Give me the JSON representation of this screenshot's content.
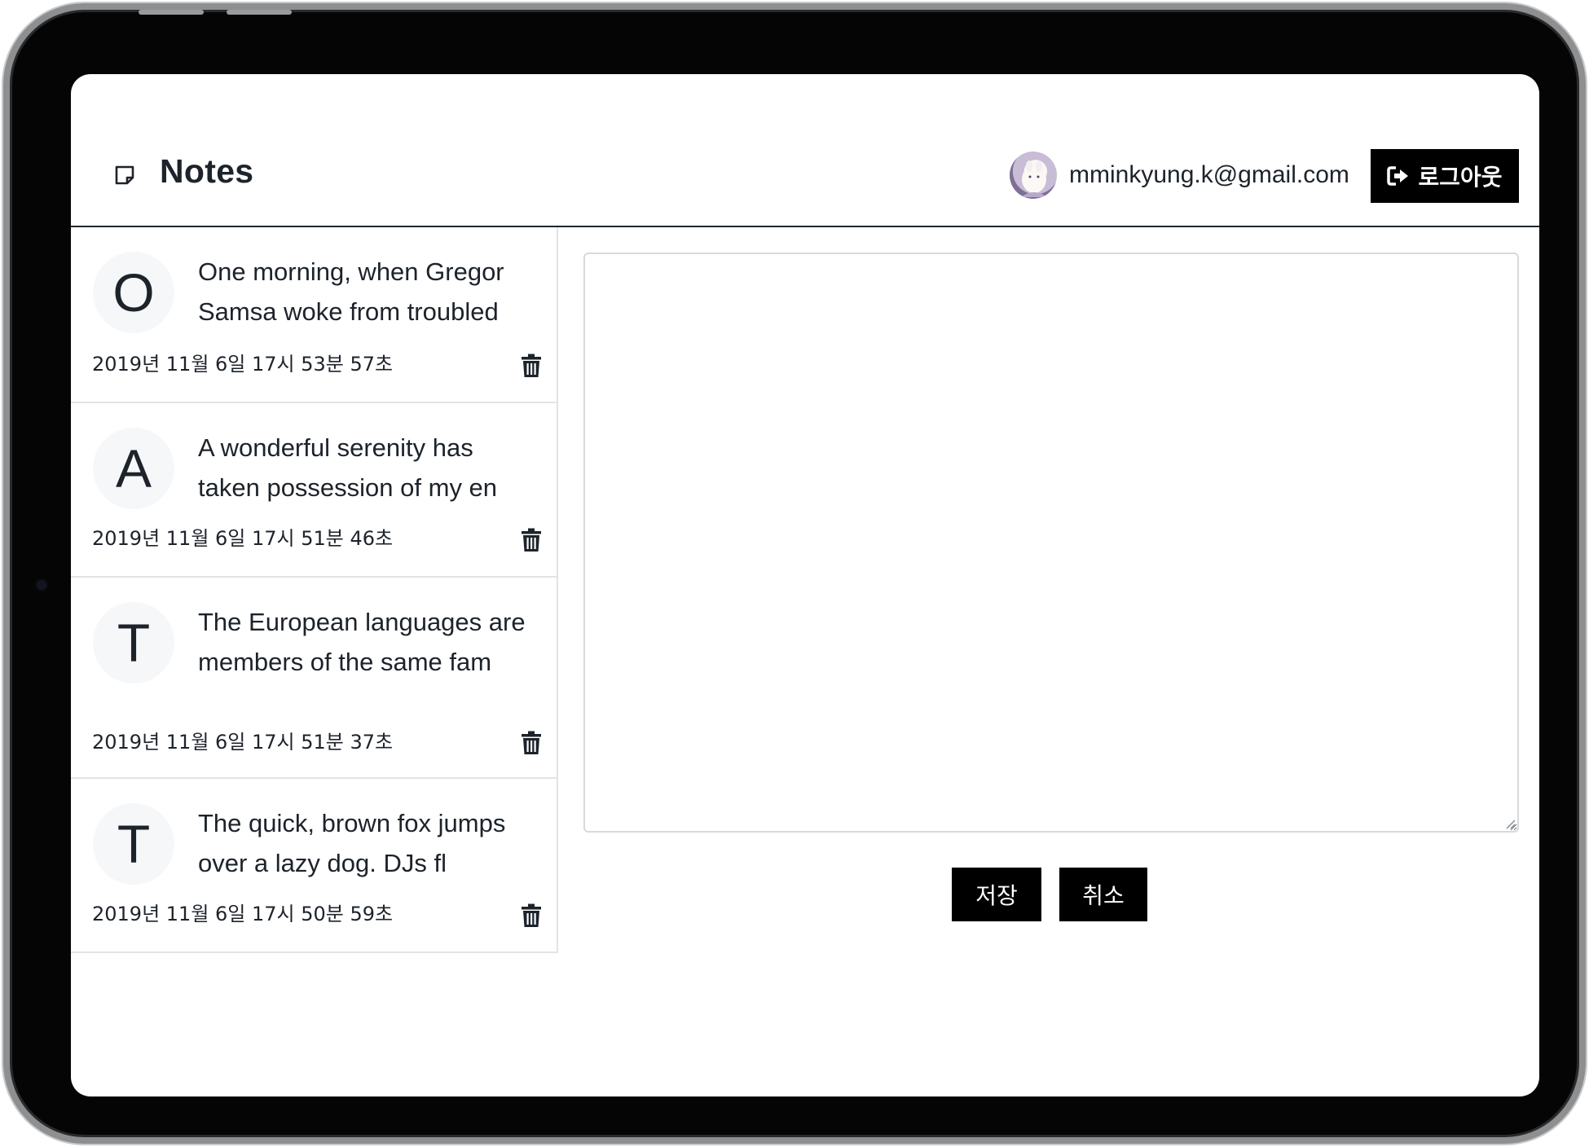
{
  "app": {
    "title": "Notes",
    "icon": "sticky-note-icon"
  },
  "user": {
    "email": "mminkyung.k@gmail.com",
    "avatar_icon": "user-avatar"
  },
  "header": {
    "logout_label": "로그아웃",
    "logout_icon": "sign-out-icon"
  },
  "notes": [
    {
      "initial": "O",
      "text": "One morning, when Gregor Samsa woke from troubled",
      "date": "2019년 11월 6일 17시 53분 57초"
    },
    {
      "initial": "A",
      "text": "A wonderful serenity has taken possession of my en",
      "date": "2019년 11월 6일 17시 51분 46초"
    },
    {
      "initial": "T",
      "text": "The European languages are members of the same fam",
      "date": "2019년 11월 6일 17시 51분 37초"
    },
    {
      "initial": "T",
      "text": "The quick, brown fox jumps over a lazy dog. DJs fl",
      "date": "2019년 11월 6일 17시 50분 59초"
    }
  ],
  "editor": {
    "value": "",
    "placeholder": ""
  },
  "actions": {
    "save_label": "저장",
    "cancel_label": "취소"
  },
  "colors": {
    "button_bg": "#000000",
    "text": "#1d232b",
    "divider": "#e1e4e8"
  }
}
